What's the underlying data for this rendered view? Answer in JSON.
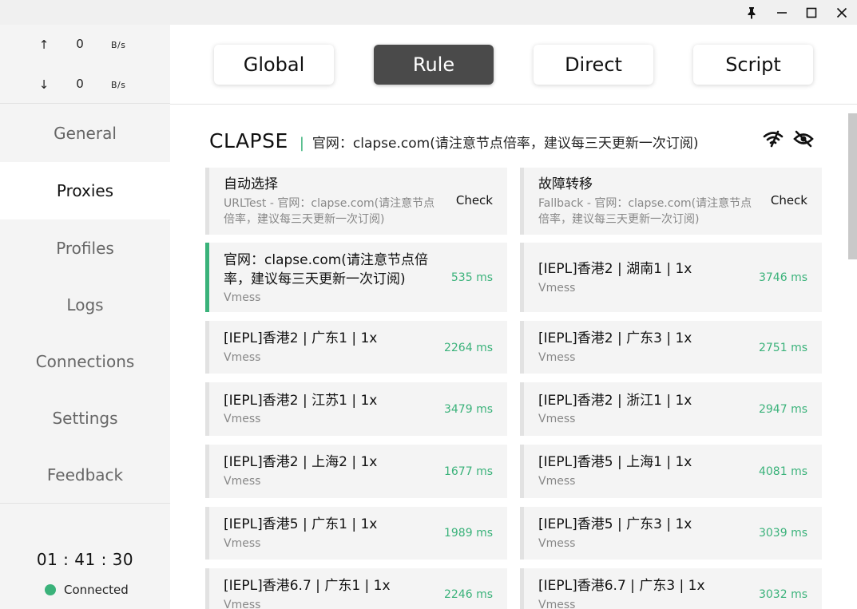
{
  "titlebar": {
    "buttons": [
      "pin-icon",
      "minimize-icon",
      "maximize-icon",
      "close-icon"
    ]
  },
  "traffic": {
    "up": {
      "arrow": "↑",
      "value": "0",
      "unit": "B/s"
    },
    "down": {
      "arrow": "↓",
      "value": "0",
      "unit": "B/s"
    }
  },
  "nav": [
    "General",
    "Proxies",
    "Profiles",
    "Logs",
    "Connections",
    "Settings",
    "Feedback"
  ],
  "nav_active": "Proxies",
  "status": {
    "timer": "01 : 41 : 30",
    "connection": "Connected",
    "connection_color": "#3ab27a"
  },
  "modes": [
    "Global",
    "Rule",
    "Direct",
    "Script"
  ],
  "mode_active": "Rule",
  "group": {
    "name": "CLAPSE",
    "separator": "|",
    "now": "官网：clapse.com(请注意节点倍率，建议每三天更新一次订阅)",
    "icons": [
      "wifi-speed-icon",
      "eye-off-icon"
    ]
  },
  "selectors": [
    {
      "name": "自动选择",
      "sub": "URLTest - 官网：clapse.com(请注意节点倍率，建议每三天更新一次订阅)",
      "action": "Check"
    },
    {
      "name": "故障转移",
      "sub": "Fallback - 官网：clapse.com(请注意节点倍率，建议每三天更新一次订阅)",
      "action": "Check"
    }
  ],
  "proxies": [
    {
      "name": "官网：clapse.com(请注意节点倍率，建议每三天更新一次订阅)",
      "type": "Vmess",
      "delay": "535 ms",
      "selected": true
    },
    {
      "name": "[IEPL]香港2 | 湖南1 | 1x",
      "type": "Vmess",
      "delay": "3746 ms"
    },
    {
      "name": "[IEPL]香港2 | 广东1 | 1x",
      "type": "Vmess",
      "delay": "2264 ms"
    },
    {
      "name": "[IEPL]香港2 | 广东3 | 1x",
      "type": "Vmess",
      "delay": "2751 ms"
    },
    {
      "name": "[IEPL]香港2 | 江苏1 | 1x",
      "type": "Vmess",
      "delay": "3479 ms"
    },
    {
      "name": "[IEPL]香港2 | 浙江1 | 1x",
      "type": "Vmess",
      "delay": "2947 ms"
    },
    {
      "name": "[IEPL]香港2 | 上海2 | 1x",
      "type": "Vmess",
      "delay": "1677 ms"
    },
    {
      "name": "[IEPL]香港5 | 上海1 | 1x",
      "type": "Vmess",
      "delay": "4081 ms"
    },
    {
      "name": "[IEPL]香港5 | 广东1 | 1x",
      "type": "Vmess",
      "delay": "1989 ms"
    },
    {
      "name": "[IEPL]香港5 | 广东3 | 1x",
      "type": "Vmess",
      "delay": "3039 ms"
    },
    {
      "name": "[IEPL]香港6.7 | 广东1 | 1x",
      "type": "Vmess",
      "delay": "2246 ms"
    },
    {
      "name": "[IEPL]香港6.7 | 广东3 | 1x",
      "type": "Vmess",
      "delay": "3032 ms"
    }
  ]
}
